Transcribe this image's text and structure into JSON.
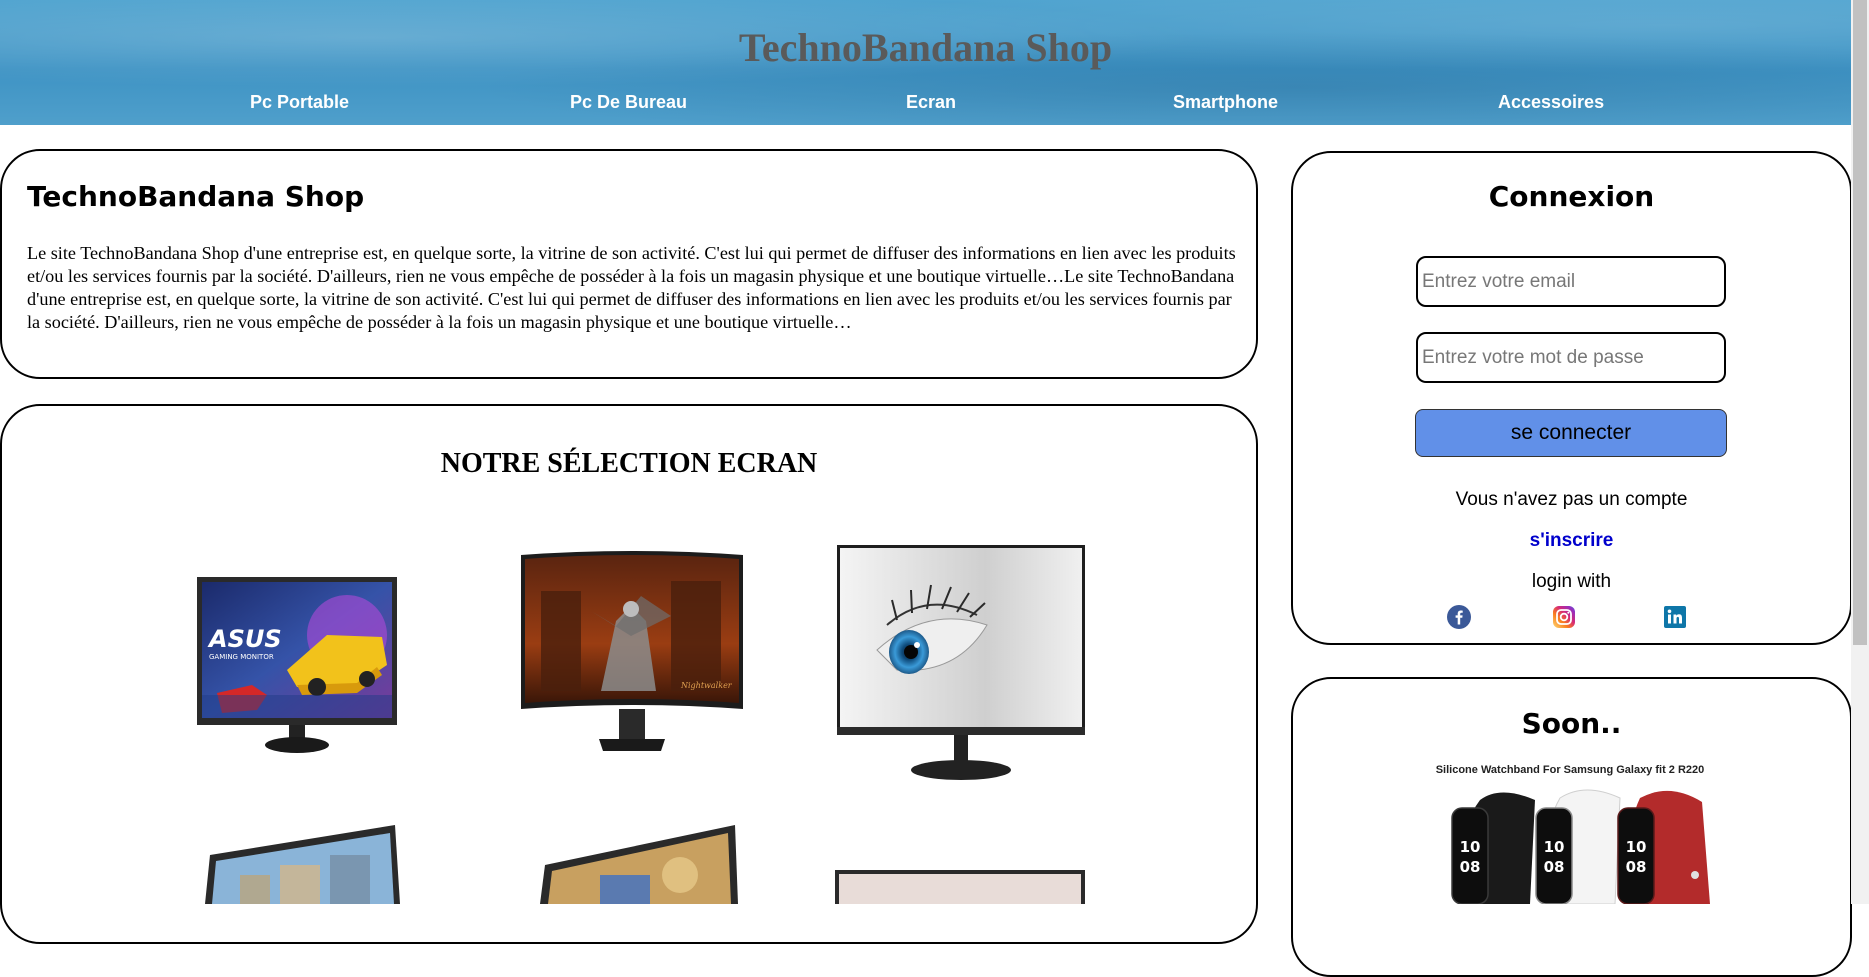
{
  "header": {
    "title": "TechnoBandana Shop",
    "nav": [
      {
        "label": "Pc Portable"
      },
      {
        "label": "Pc De Bureau"
      },
      {
        "label": "Ecran"
      },
      {
        "label": "Smartphone"
      },
      {
        "label": "Accessoires"
      }
    ]
  },
  "intro": {
    "title": "TechnoBandana Shop",
    "text": "Le site TechnoBandana Shop d'une entreprise est, en quelque sorte, la vitrine de son activité. C'est lui qui permet de diffuser des informations en lien avec les produits et/ou les services fournis par la société. D'ailleurs, rien ne vous empêche de posséder à la fois un magasin physique et une boutique virtuelle…Le site TechnoBandana d'une entreprise est, en quelque sorte, la vitrine de son activité. C'est lui qui permet de diffuser des informations en lien avec les produits et/ou les services fournis par la société. D'ailleurs, rien ne vous empêche de posséder à la fois un magasin physique et une boutique virtuelle…"
  },
  "selection": {
    "title": "NOTRE SÉLECTION ECRAN",
    "monitor1_brand": "ASUS",
    "monitor1_sub": "GAMING MONITOR",
    "monitor2_caption": "Nightwalker"
  },
  "login": {
    "title": "Connexion",
    "email_placeholder": "Entrez votre email",
    "password_placeholder": "Entrez votre mot de passe",
    "submit_label": "se connecter",
    "no_account_text": "Vous n'avez pas un compte",
    "signup_label": "s'inscrire",
    "login_with_text": "login with",
    "social_icons": [
      "facebook-icon",
      "instagram-icon",
      "linkedin-icon"
    ]
  },
  "soon": {
    "title": "Soon..",
    "product_caption": "Silicone Watchband For Samsung Galaxy fit 2 R220",
    "watch_time": [
      "10",
      "08"
    ]
  },
  "colors": {
    "button_accent": "#6190e8",
    "link": "#0000cc",
    "header_bg": "#4fa3cf"
  }
}
